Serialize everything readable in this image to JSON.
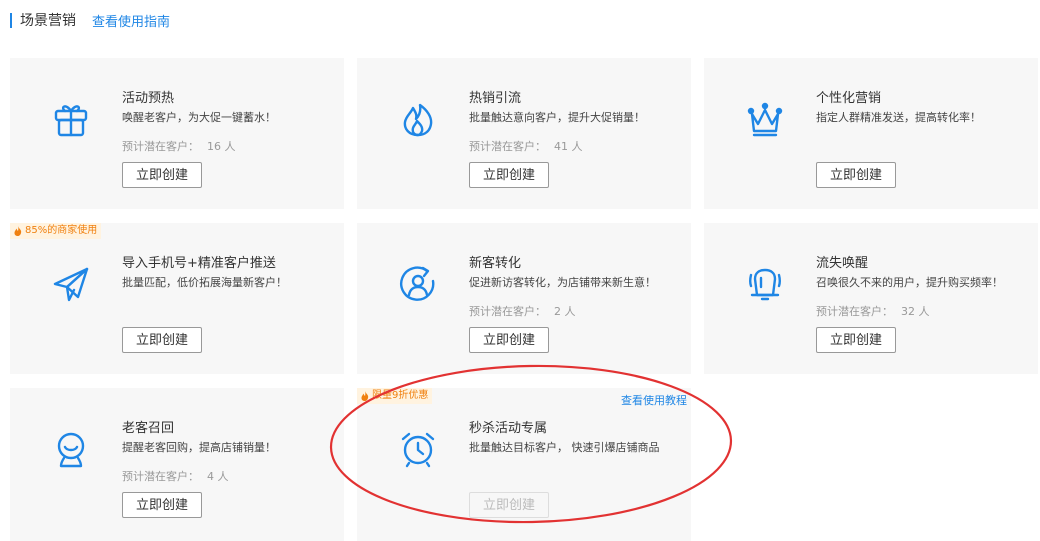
{
  "header": {
    "title": "场景营销",
    "guide_link": "查看使用指南"
  },
  "cards": [
    {
      "title": "活动预热",
      "desc": "唤醒老客户，为大促一键蓄水！",
      "potential_label": "预计潜在客户：",
      "potential_value": "16 人",
      "button": "立即创建",
      "icon": "gift-icon"
    },
    {
      "title": "热销引流",
      "desc": "批量触达意向客户，提升大促销量！",
      "potential_label": "预计潜在客户：",
      "potential_value": "41 人",
      "button": "立即创建",
      "icon": "flame-icon"
    },
    {
      "title": "个性化营销",
      "desc": "指定人群精准发送，提高转化率！",
      "button": "立即创建",
      "icon": "crown-icon"
    },
    {
      "badge": "85%的商家使用",
      "title": "导入手机号+精准客户推送",
      "desc": "批量匹配，低价拓展海量新客户！",
      "button": "立即创建",
      "icon": "paper-plane-icon"
    },
    {
      "title": "新客转化",
      "desc": "促进新访客转化，为店铺带来新生意！",
      "potential_label": "预计潜在客户：",
      "potential_value": "2 人",
      "button": "立即创建",
      "icon": "user-refresh-icon"
    },
    {
      "title": "流失唤醒",
      "desc": "召唤很久不来的用户，提升购买频率！",
      "potential_label": "预计潜在客户：",
      "potential_value": "32 人",
      "button": "立即创建",
      "icon": "bell-icon"
    },
    {
      "title": "老客召回",
      "desc": "提醒老客回购，提高店铺销量！",
      "potential_label": "预计潜在客户：",
      "potential_value": "4 人",
      "button": "立即创建",
      "icon": "smile-user-icon"
    },
    {
      "badge": "限量9折优惠",
      "tutorial_link": "查看使用教程",
      "title": "秒杀活动专属",
      "desc": "批量触达目标客户， 快速引爆店铺商品",
      "button": "立即创建",
      "button_disabled": true,
      "icon": "alarm-clock-icon"
    }
  ],
  "colors": {
    "accent": "#1f86e5",
    "badge_text": "#f0800f",
    "annotation": "#e23232",
    "card_bg": "#f7f7f7"
  }
}
